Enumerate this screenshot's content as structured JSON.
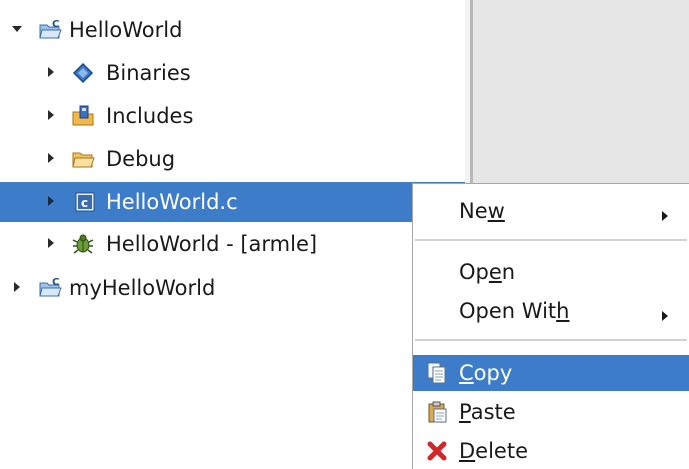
{
  "tree": {
    "items": [
      {
        "label": "HelloWorld",
        "icon": "c-project-folder-icon",
        "expanded": true
      },
      {
        "label": "Binaries",
        "icon": "binaries-diamond-icon"
      },
      {
        "label": "Includes",
        "icon": "includes-folder-icon"
      },
      {
        "label": "Debug",
        "icon": "folder-icon"
      },
      {
        "label": "HelloWorld.c",
        "icon": "c-source-file-icon",
        "selected": true
      },
      {
        "label": "HelloWorld - [armle]",
        "icon": "bug-binary-icon"
      },
      {
        "label": "myHelloWorld",
        "icon": "c-project-folder-icon",
        "expanded": false
      }
    ]
  },
  "context_menu": {
    "new": {
      "pre": "Ne",
      "mn": "w",
      "post": ""
    },
    "open": {
      "pre": "Op",
      "mn": "e",
      "post": "n"
    },
    "open_with": {
      "pre": "Open Wit",
      "mn": "h",
      "post": ""
    },
    "copy": {
      "pre": "",
      "mn": "C",
      "post": "opy"
    },
    "paste": {
      "pre": "",
      "mn": "P",
      "post": "aste"
    },
    "delete": {
      "pre": "",
      "mn": "D",
      "post": "elete"
    }
  },
  "colors": {
    "selection": "#3d7cc9",
    "divider": "#b9b9b9",
    "right_pane": "#e6e6e6",
    "delete_red": "#d2262a"
  }
}
